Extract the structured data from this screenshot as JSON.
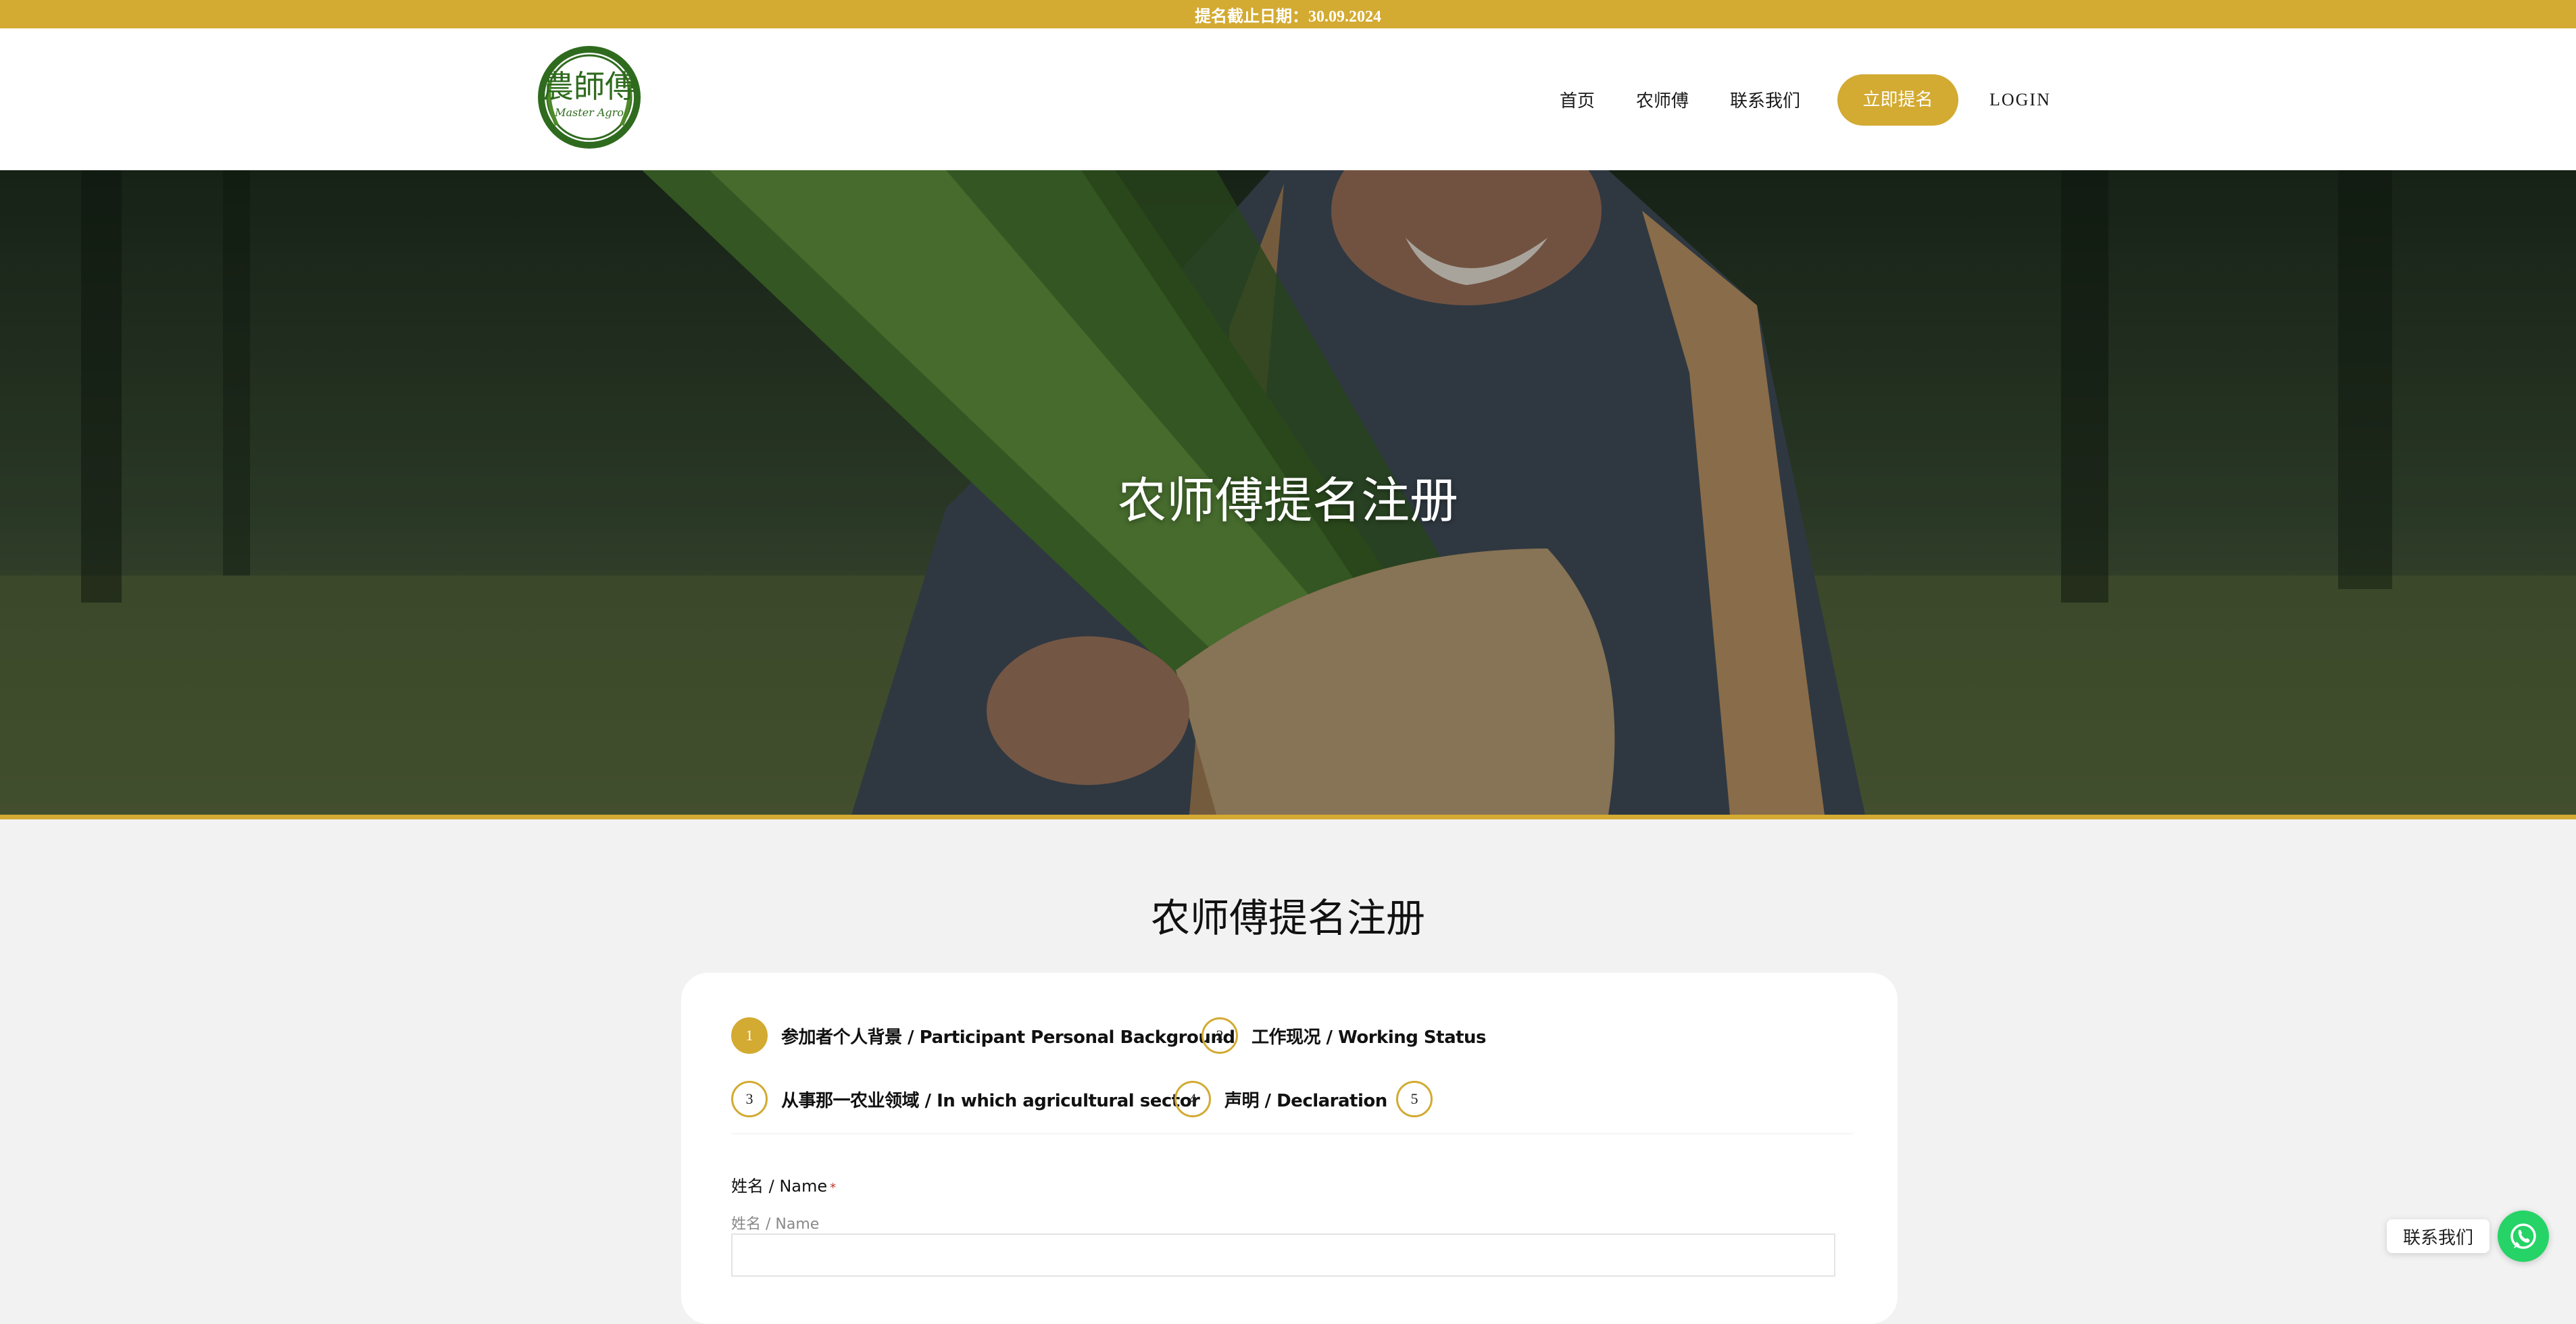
{
  "topbar": {
    "deadline_text": "提名截止日期：30.09.2024"
  },
  "header": {
    "logo_text": "農師傅",
    "logo_subtext": "Master Agro",
    "nav": [
      {
        "label": "首页"
      },
      {
        "label": "农师傅"
      },
      {
        "label": "联系我们"
      }
    ],
    "cta_label": "立即提名",
    "login_label": "LOGIN"
  },
  "hero": {
    "title": "农师傅提名注册"
  },
  "form": {
    "page_title": "农师傅提名注册",
    "steps": [
      {
        "num": "1",
        "label": "参加者个人背景 / Participant Personal Background",
        "active": true
      },
      {
        "num": "2",
        "label": "工作现况 / Working Status",
        "active": false
      },
      {
        "num": "3",
        "label": "从事那一农业领域 / In which agricultural sector",
        "active": false
      },
      {
        "num": "4",
        "label": "声明 / Declaration",
        "active": false
      },
      {
        "num": "5",
        "label": "",
        "active": false
      }
    ],
    "name_field": {
      "label": "姓名 / Name",
      "required_mark": "*",
      "hint": "姓名 / Name",
      "value": ""
    }
  },
  "whatsapp": {
    "label": "联系我们",
    "icon": "whatsapp-icon"
  },
  "colors": {
    "accent": "#d3aa32",
    "whatsapp": "#25d366",
    "background": "#f2f2f2"
  }
}
